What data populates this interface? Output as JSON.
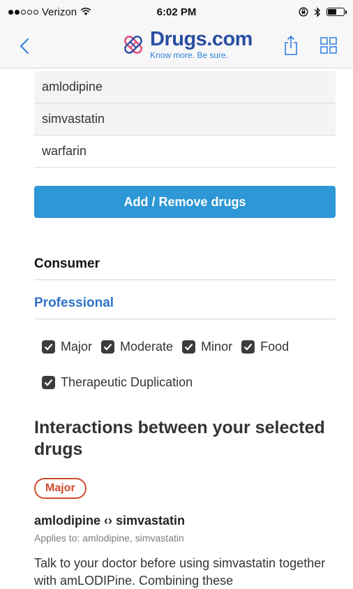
{
  "status_bar": {
    "carrier": "Verizon",
    "time": "6:02 PM"
  },
  "nav": {
    "logo_title": "Drugs.com",
    "logo_tagline": "Know more. Be sure."
  },
  "drugs": [
    {
      "name": "amlodipine"
    },
    {
      "name": "simvastatin"
    },
    {
      "name": "warfarin"
    }
  ],
  "add_remove_label": "Add / Remove drugs",
  "tabs": {
    "consumer": "Consumer",
    "professional": "Professional"
  },
  "filters": {
    "major": "Major",
    "moderate": "Moderate",
    "minor": "Minor",
    "food": "Food",
    "therapeutic": "Therapeutic Duplication"
  },
  "interactions": {
    "heading": "Interactions between your selected drugs",
    "items": [
      {
        "severity": "Major",
        "title": "amlodipine ‹› simvastatin",
        "applies_to": "Applies to: amlodipine, simvastatin",
        "description": "Talk to your doctor before using simvastatin together with amLODIPine. Combining these"
      }
    ]
  },
  "colors": {
    "brand_blue": "#2a4fa2",
    "button_blue": "#2e97d6",
    "link_blue": "#2f73c9",
    "major_red": "#d24b2f"
  }
}
